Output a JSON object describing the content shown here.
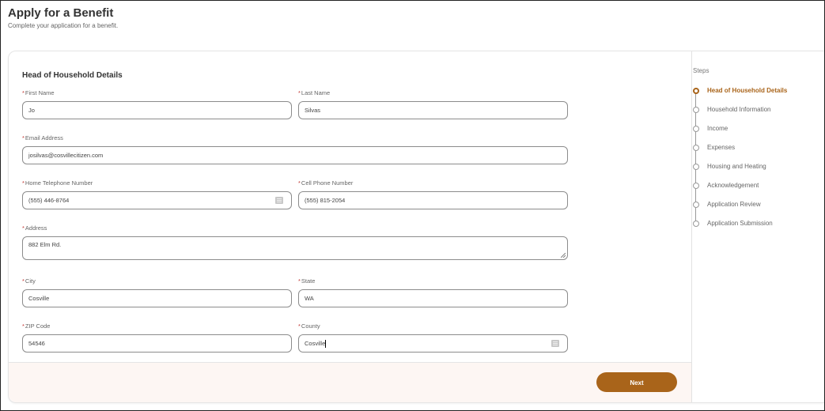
{
  "header": {
    "title": "Apply for a Benefit",
    "subtitle": "Complete your application for a benefit."
  },
  "form": {
    "section_title": "Head of Household Details",
    "required_marker": "*",
    "fields": {
      "first_name": {
        "label": "First Name",
        "value": "Jo"
      },
      "last_name": {
        "label": "Last Name",
        "value": "Silvas"
      },
      "email": {
        "label": "Email Address",
        "value": "josilvas@cosvillecitizen.com"
      },
      "home_phone": {
        "label": "Home Telephone Number",
        "value": "(555) 446-8764"
      },
      "cell_phone": {
        "label": "Cell Phone Number",
        "value": "(555) 815-2054"
      },
      "address": {
        "label": "Address",
        "value": "882 Elm Rd."
      },
      "city": {
        "label": "City",
        "value": "Cosville"
      },
      "state": {
        "label": "State",
        "value": "WA"
      },
      "zip": {
        "label": "ZIP Code",
        "value": "54546"
      },
      "county": {
        "label": "County",
        "value": "Cosville"
      }
    },
    "next_label": "Next"
  },
  "steps": {
    "title": "Steps",
    "active_color": "#a9641a",
    "items": [
      {
        "label": "Head of Household Details",
        "active": true
      },
      {
        "label": "Household Information",
        "active": false
      },
      {
        "label": "Income",
        "active": false
      },
      {
        "label": "Expenses",
        "active": false
      },
      {
        "label": "Housing and Heating",
        "active": false
      },
      {
        "label": "Acknowledgement",
        "active": false
      },
      {
        "label": "Application Review",
        "active": false
      },
      {
        "label": "Application Submission",
        "active": false
      }
    ]
  }
}
